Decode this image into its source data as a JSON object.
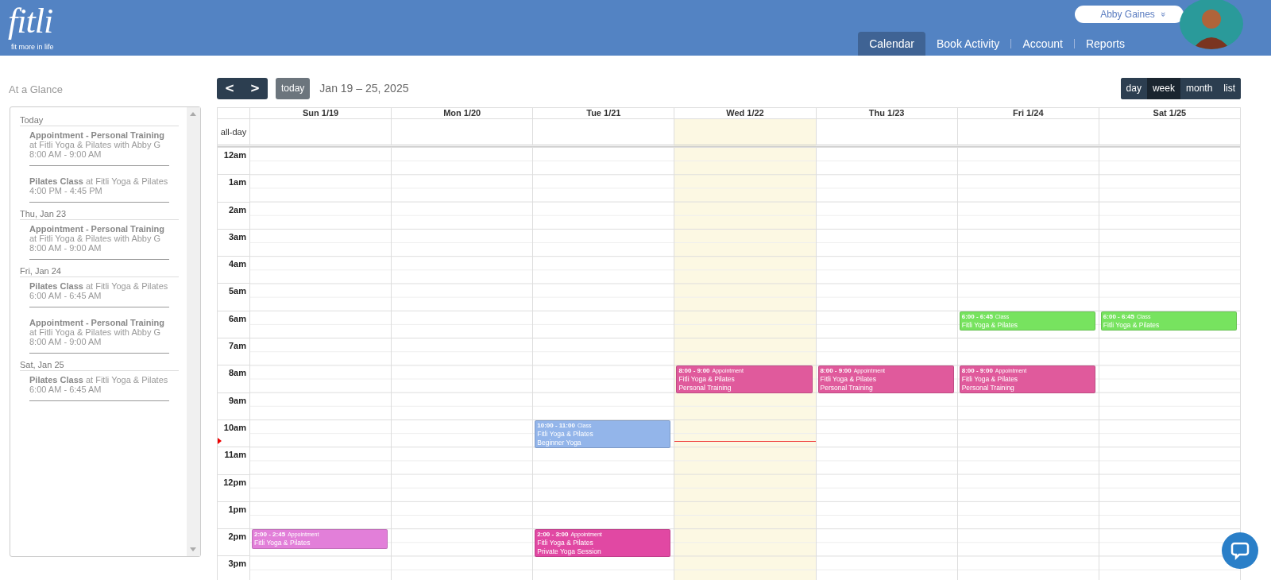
{
  "header": {
    "logo": {
      "wordmark": "fitli",
      "tagline": "fit more in life"
    },
    "user_menu": {
      "name": "Abby Gaines",
      "caret": "»"
    },
    "nav": [
      {
        "label": "Calendar",
        "selected": true
      },
      {
        "label": "Book Activity",
        "selected": false
      },
      {
        "label": "Account",
        "selected": false
      },
      {
        "label": "Reports",
        "selected": false
      }
    ]
  },
  "sidebar": {
    "title": "At a Glance",
    "groups": [
      {
        "date": "Today",
        "items": [
          {
            "text": "**Appointment - Personal Training** at Fitli Yoga & Pilates with Abby G",
            "time": "8:00 AM - 9:00 AM"
          },
          {
            "text": "**Pilates Class** at Fitli Yoga & Pilates",
            "time": "4:00 PM - 4:45 PM"
          }
        ]
      },
      {
        "date": "Thu, Jan 23",
        "items": [
          {
            "text": "**Appointment - Personal Training** at Fitli Yoga & Pilates with Abby G",
            "time": "8:00 AM - 9:00 AM"
          }
        ]
      },
      {
        "date": "Fri, Jan 24",
        "items": [
          {
            "text": "**Pilates Class** at Fitli Yoga & Pilates",
            "time": "6:00 AM - 6:45 AM"
          },
          {
            "text": "**Appointment - Personal Training** at Fitli Yoga & Pilates with Abby G",
            "time": "8:00 AM - 9:00 AM"
          }
        ]
      },
      {
        "date": "Sat, Jan 25",
        "items": [
          {
            "text": "**Pilates Class** at Fitli Yoga & Pilates",
            "time": "6:00 AM - 6:45 AM"
          }
        ]
      }
    ]
  },
  "calendar": {
    "prev": "<",
    "next": ">",
    "today_button": "today",
    "range": "Jan 19 – 25, 2025",
    "views": [
      {
        "label": "day",
        "selected": false
      },
      {
        "label": "week",
        "selected": true
      },
      {
        "label": "month",
        "selected": false
      },
      {
        "label": "list",
        "selected": false
      }
    ],
    "all_day_label": "all-day",
    "hours": [
      "12am",
      "1am",
      "2am",
      "3am",
      "4am",
      "5am",
      "6am",
      "7am",
      "8am",
      "9am",
      "10am",
      "11am",
      "12pm",
      "1pm",
      "2pm",
      "3pm"
    ],
    "now": {
      "level": 0.55
    },
    "days": [
      {
        "label": "Sun 1/19",
        "today": false,
        "events": [
          {
            "time": "2:00 - 2:45",
            "type": "Appointment",
            "lines": [
              "Fitli Yoga & Pilates"
            ],
            "color": "#e27fd9"
          }
        ]
      },
      {
        "label": "Mon 1/20",
        "today": false
      },
      {
        "label": "Tue 1/21",
        "today": false,
        "events": [
          {
            "time": "10:00 - 11:00",
            "type": "Class",
            "lines": [
              "Fitli Yoga & Pilates",
              "Beginner Yoga"
            ],
            "color": "#93b5ea"
          },
          {
            "time": "2:00 - 3:00",
            "type": "Appointment",
            "lines": [
              "Fitli Yoga & Pilates",
              "Private Yoga Session"
            ],
            "color": "#e148a3"
          }
        ]
      },
      {
        "label": "Wed 1/22",
        "today": true,
        "events": [
          {
            "time": "8:00 - 9:00",
            "type": "Appointment",
            "lines": [
              "Fitli Yoga & Pilates",
              "Personal Training"
            ],
            "color": "#e05a9c"
          }
        ]
      },
      {
        "label": "Thu 1/23",
        "today": false,
        "events": [
          {
            "time": "8:00 - 9:00",
            "type": "Appointment",
            "lines": [
              "Fitli Yoga & Pilates",
              "Personal Training"
            ],
            "color": "#e05a9c"
          }
        ]
      },
      {
        "label": "Fri 1/24",
        "today": false,
        "events": [
          {
            "time": "6:00 - 6:45",
            "type": "Class",
            "lines": [
              "Fitli Yoga & Pilates"
            ],
            "color": "#77e35f"
          },
          {
            "time": "8:00 - 9:00",
            "type": "Appointment",
            "lines": [
              "Fitli Yoga & Pilates",
              "Personal Training"
            ],
            "color": "#e05a9c"
          }
        ]
      },
      {
        "label": "Sat 1/25",
        "today": false,
        "events": [
          {
            "time": "6:00 - 6:45",
            "type": "Class",
            "lines": [
              "Fitli Yoga & Pilates"
            ],
            "color": "#77e35f"
          }
        ]
      }
    ]
  }
}
